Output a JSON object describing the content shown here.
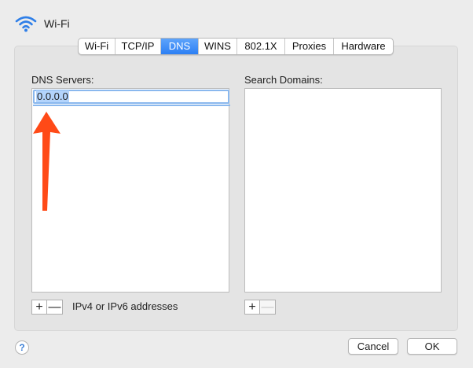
{
  "window": {
    "title": "Wi-Fi",
    "icon": "wifi-icon"
  },
  "tabs": [
    {
      "label": "Wi-Fi",
      "active": false
    },
    {
      "label": "TCP/IP",
      "active": false
    },
    {
      "label": "DNS",
      "active": true
    },
    {
      "label": "WINS",
      "active": false
    },
    {
      "label": "802.1X",
      "active": false
    },
    {
      "label": "Proxies",
      "active": false
    },
    {
      "label": "Hardware",
      "active": false
    }
  ],
  "dns": {
    "label": "DNS Servers:",
    "entries": [
      "0.0.0.0"
    ],
    "add_label": "+",
    "remove_label": "—",
    "hint": "IPv4 or IPv6 addresses"
  },
  "search": {
    "label": "Search Domains:",
    "entries": [],
    "add_label": "+",
    "remove_label": "—"
  },
  "footer": {
    "help_label": "?",
    "cancel_label": "Cancel",
    "ok_label": "OK"
  },
  "colors": {
    "accent": "#3d8ef7",
    "arrow": "#ff4a17",
    "selection": "#b3d4fc"
  }
}
